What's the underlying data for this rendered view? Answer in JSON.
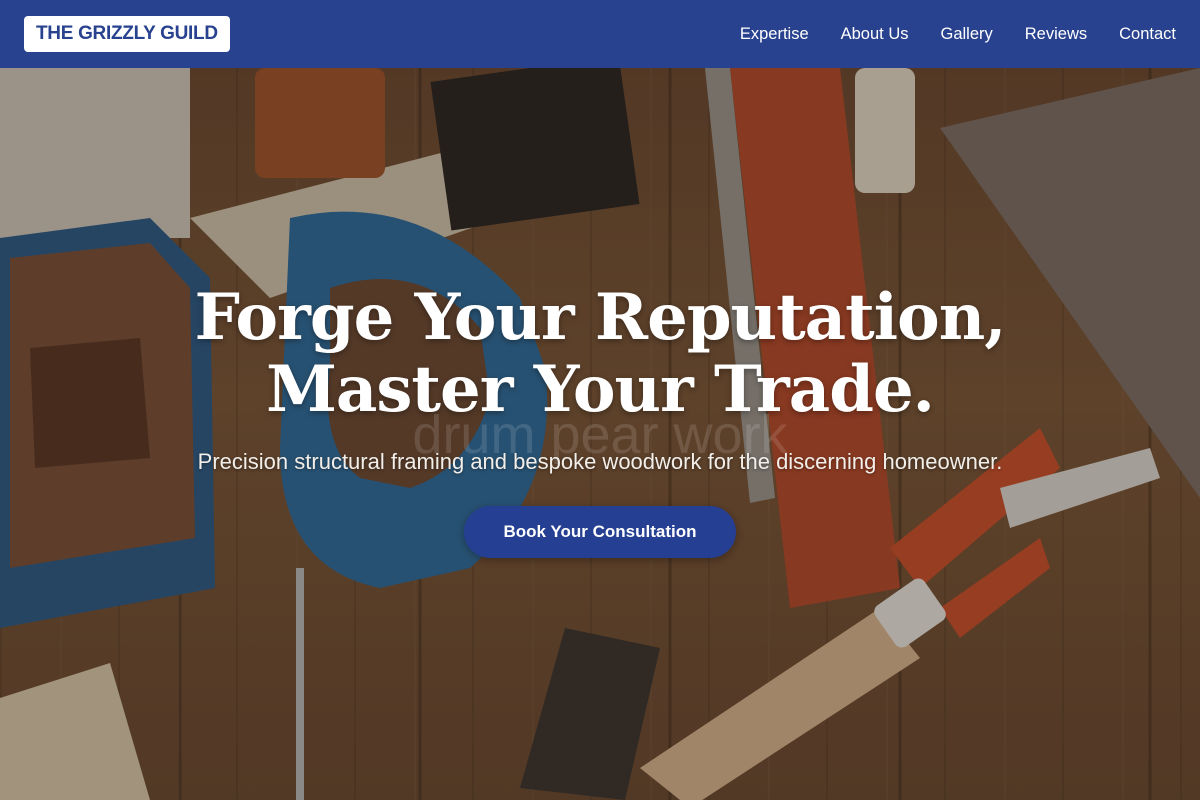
{
  "brand": {
    "logo_text": "THE GRIZZLY GUILD"
  },
  "nav": {
    "items": [
      {
        "label": "Expertise"
      },
      {
        "label": "About Us"
      },
      {
        "label": "Gallery"
      },
      {
        "label": "Reviews"
      },
      {
        "label": "Contact"
      }
    ]
  },
  "hero": {
    "title_line1": "Forge Your Reputation,",
    "title_line2": "Master Your Trade.",
    "ghost_text": "drum pear work",
    "subtitle": "Precision structural framing and bespoke woodwork for the discerning homeowner.",
    "cta_label": "Book Your Consultation",
    "background_description_icon": "tools-on-workbench-photo"
  },
  "colors": {
    "nav_bg": "#28428f",
    "accent": "#253f92",
    "logo_bg": "#ffffff",
    "text_light": "#ffffff"
  }
}
